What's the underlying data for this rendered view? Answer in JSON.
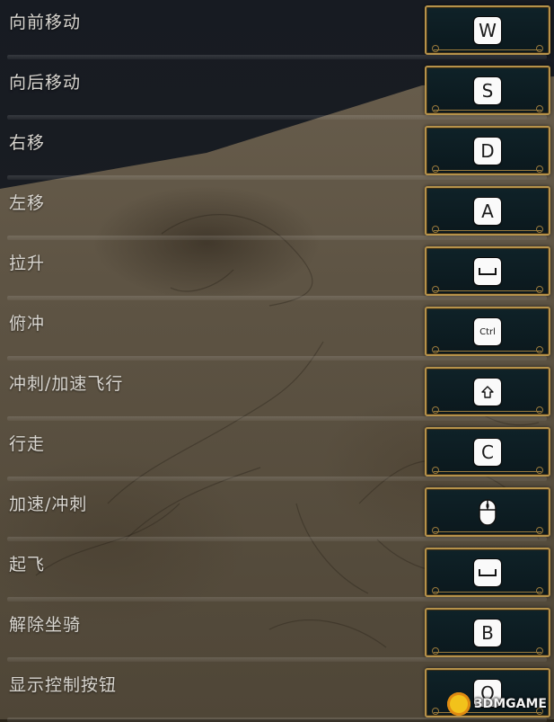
{
  "keybindings": [
    {
      "action": "向前移动",
      "key": "W",
      "key_icon": "letter-key"
    },
    {
      "action": "向后移动",
      "key": "S",
      "key_icon": "letter-key"
    },
    {
      "action": "右移",
      "key": "D",
      "key_icon": "letter-key"
    },
    {
      "action": "左移",
      "key": "A",
      "key_icon": "letter-key"
    },
    {
      "action": "拉升",
      "key": "",
      "key_icon": "spacebar-icon"
    },
    {
      "action": "俯冲",
      "key": "Ctrl",
      "key_icon": "letter-key"
    },
    {
      "action": "冲刺/加速飞行",
      "key": "",
      "key_icon": "shift-icon"
    },
    {
      "action": "行走",
      "key": "C",
      "key_icon": "letter-key"
    },
    {
      "action": "加速/冲刺",
      "key": "",
      "key_icon": "mouse-icon"
    },
    {
      "action": "起飞",
      "key": "",
      "key_icon": "spacebar-icon"
    },
    {
      "action": "解除坐骑",
      "key": "B",
      "key_icon": "letter-key"
    },
    {
      "action": "显示控制按钮",
      "key": "Q",
      "key_icon": "letter-key"
    }
  ],
  "watermark": {
    "text": "3DMGAME"
  },
  "colors": {
    "label_text": "#d9d6d0",
    "slot_border": "#b6924a",
    "slot_bg": "#0f2228",
    "key_bg": "#fafafa"
  }
}
